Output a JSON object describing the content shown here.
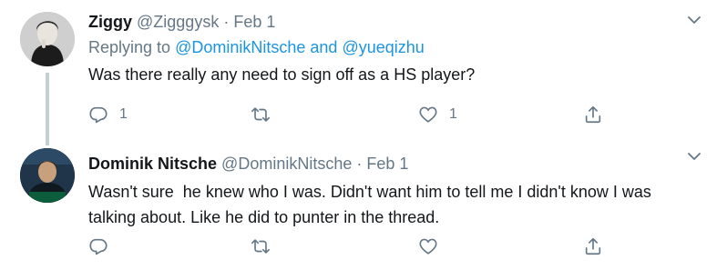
{
  "tweets": [
    {
      "name": "Ziggy",
      "handle": "@Zigggysk",
      "separator": "·",
      "date": "Feb 1",
      "replying_prefix": "Replying to",
      "replying_user1": "@DominikNitsche",
      "replying_and": "and",
      "replying_user2": "@yueqizhu",
      "text": "Was there really any need to sign off as a HS player?",
      "reply_count": "1",
      "retweet_count": "",
      "like_count": "1"
    },
    {
      "name": "Dominik Nitsche",
      "handle": "@DominikNitsche",
      "separator": "·",
      "date": "Feb 1",
      "text": "Wasn't sure  he knew who I was. Didn't want him to tell me I didn't know I was talking about. Like he did to punter in the thread.",
      "reply_count": "",
      "retweet_count": "",
      "like_count": ""
    }
  ],
  "colors": {
    "text": "#14171a",
    "secondary": "#657786",
    "link": "#1b95e0",
    "thread_line": "#c4cfd6"
  },
  "icons": [
    "reply-icon",
    "retweet-icon",
    "like-icon",
    "share-icon",
    "chevron-down-icon"
  ]
}
